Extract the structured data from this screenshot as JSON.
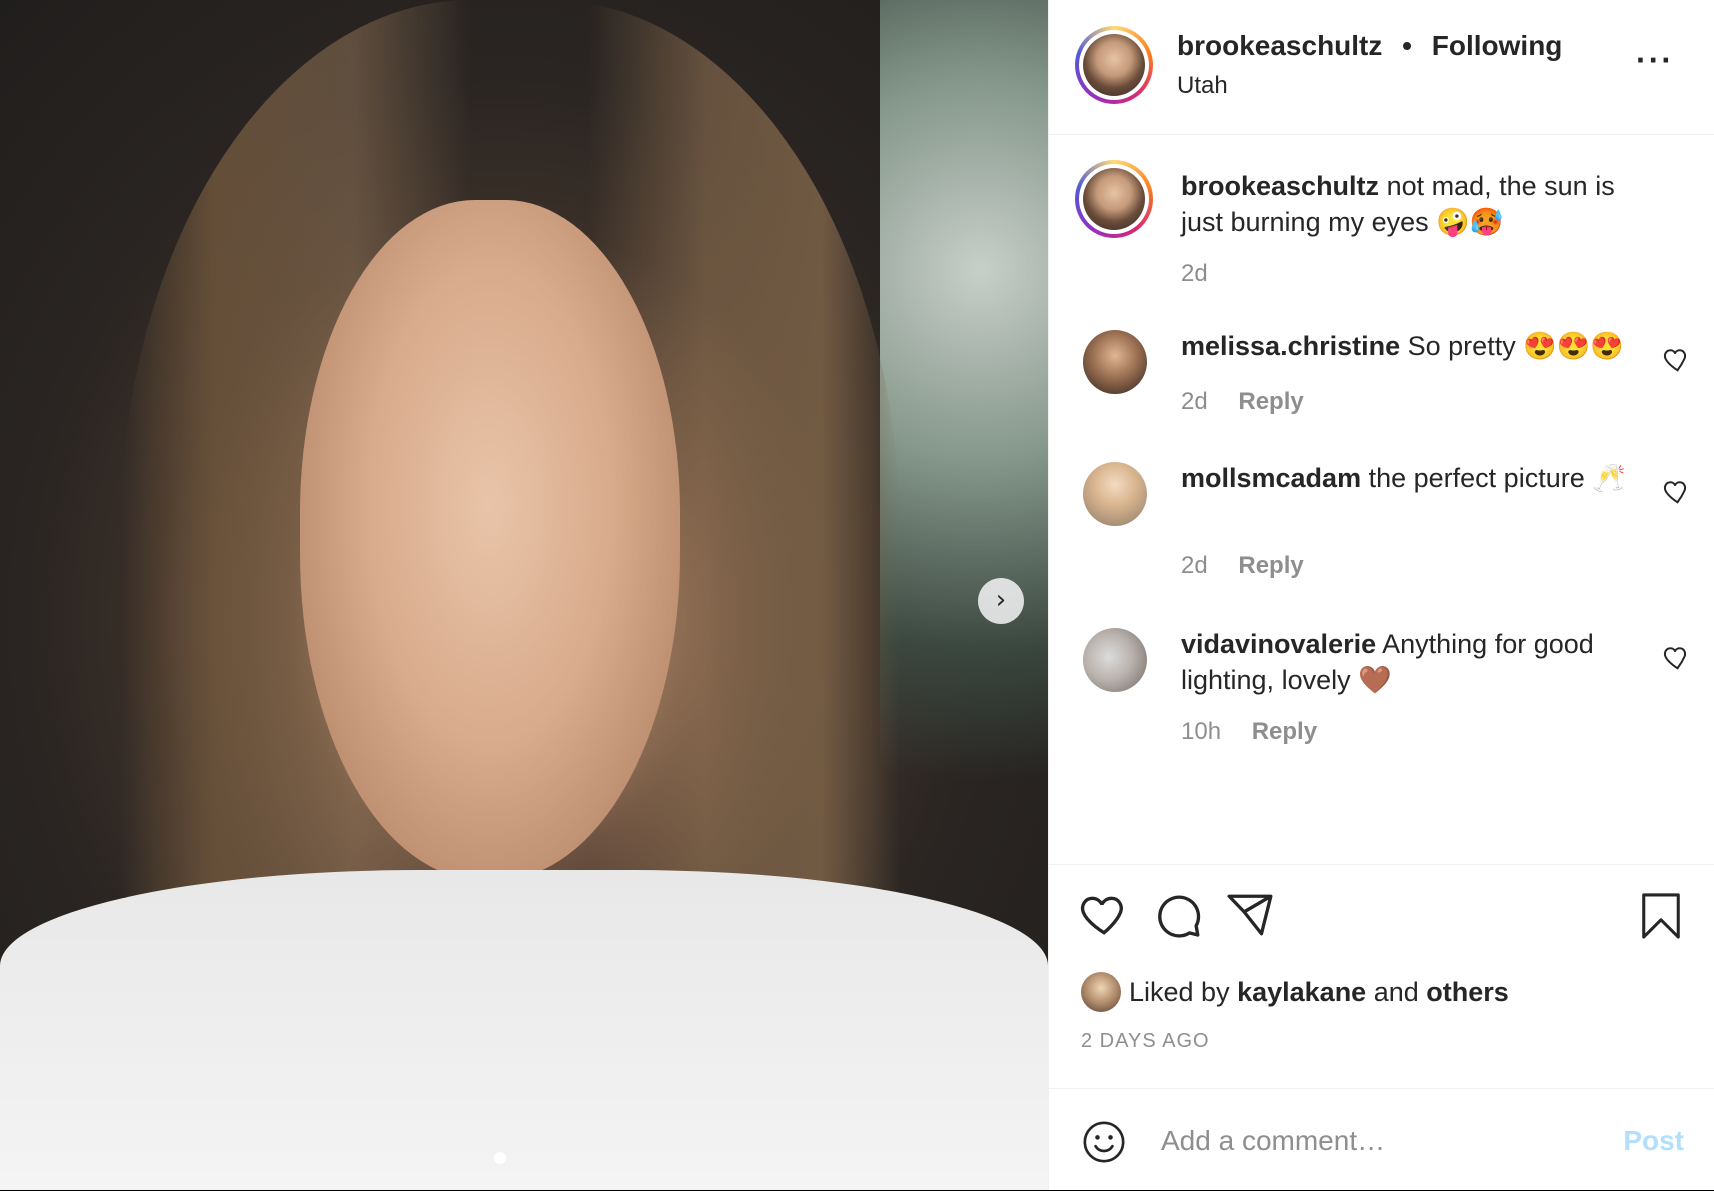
{
  "post": {
    "username": "brookeaschultz",
    "following_label": "Following",
    "separator": "•",
    "location": "Utah",
    "more_icon": "more-options-icon"
  },
  "caption": {
    "username": "brookeaschultz",
    "text": "not mad, the sun is just burning my eyes 🤪🥵",
    "time": "2d"
  },
  "comments": [
    {
      "username": "melissa.christine",
      "text": "So pretty 😍😍😍",
      "time": "2d",
      "reply": "Reply"
    },
    {
      "username": "mollsmcadam",
      "text": "the perfect picture 🥂",
      "time": "2d",
      "reply": "Reply"
    },
    {
      "username": "vidavinovalerie",
      "text": "Anything for good lighting, lovely 🤎",
      "time": "10h",
      "reply": "Reply"
    }
  ],
  "likes": {
    "prefix": "Liked by",
    "user": "kaylakane",
    "connector": "and",
    "others": "others"
  },
  "posted_ago": "2 DAYS AGO",
  "add_comment": {
    "placeholder": "Add a comment…",
    "post_label": "Post"
  },
  "colors": {
    "post_button_disabled": "#b2dffc",
    "secondary_text": "#8e8e8e",
    "primary_text": "#262626"
  }
}
